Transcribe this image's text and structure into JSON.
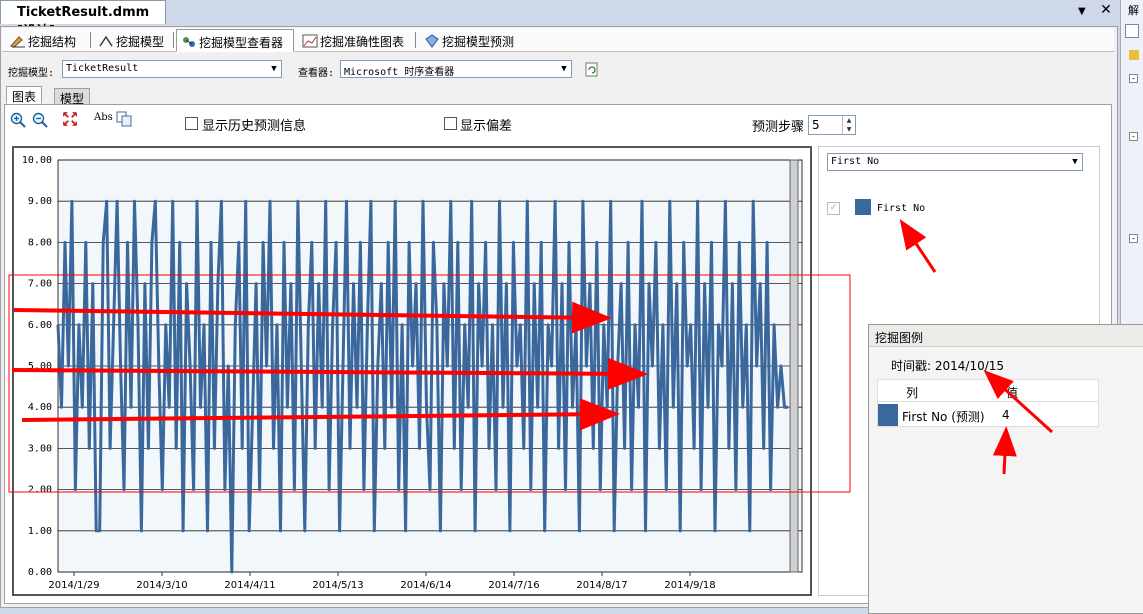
{
  "document": {
    "tab_title": "TicketResult.dmm [设计]",
    "pin_icon": "▼",
    "close_icon": "✕"
  },
  "right_strip": {
    "label": "解"
  },
  "designer_tabs": [
    {
      "label": "挖掘结构",
      "icon": "mining-structure-icon"
    },
    {
      "label": "挖掘模型",
      "icon": "mining-models-icon"
    },
    {
      "label": "挖掘模型查看器",
      "icon": "model-viewer-icon"
    },
    {
      "label": "挖掘准确性图表",
      "icon": "accuracy-chart-icon"
    },
    {
      "label": "挖掘模型预测",
      "icon": "prediction-icon"
    }
  ],
  "model_bar": {
    "model_label": "挖掘模型:",
    "model_value": "TicketResult",
    "viewer_label": "查看器:",
    "viewer_value": "Microsoft 时序查看器"
  },
  "sub_tabs": {
    "chart": "图表",
    "model": "模型"
  },
  "toolbar": {
    "abs_label": "Abs",
    "show_history": "显示历史预测信息",
    "show_deviation": "显示偏差",
    "prediction_steps_label": "预测步骤",
    "prediction_steps_value": "5"
  },
  "legend_panel": {
    "series_select": "First No",
    "item_label": "First No",
    "series_color": "#3a679c"
  },
  "popup": {
    "title": "挖掘图例",
    "timestamp": "时间戳: 2014/10/15",
    "col_header": "列",
    "val_header": "值",
    "row_label": "First No (预测)",
    "row_value": "4"
  },
  "colors": {
    "annotation": "#ff0000",
    "series": "#3a679c",
    "plot_bg": "#f2f7fc"
  },
  "chart_data": {
    "type": "line",
    "y_ticks": [
      "0.00",
      "1.00",
      "2.00",
      "3.00",
      "4.00",
      "5.00",
      "6.00",
      "7.00",
      "8.00",
      "9.00",
      "10.00"
    ],
    "x_ticks": [
      "2014/1/29",
      "2014/3/10",
      "2014/4/11",
      "2014/5/13",
      "2014/6/14",
      "2014/7/16",
      "2014/8/17",
      "2014/9/18"
    ],
    "ylim": [
      0,
      10
    ],
    "grid": true,
    "series": [
      {
        "name": "First No",
        "values": [
          6,
          4,
          8,
          5,
          9,
          2,
          6,
          4,
          8,
          3,
          7,
          1,
          1,
          8,
          9,
          3,
          6,
          9,
          5,
          2,
          8,
          4,
          9,
          6,
          1,
          7,
          3,
          8,
          9,
          5,
          2,
          6,
          4,
          9,
          3,
          8,
          1,
          7,
          5,
          2,
          9,
          4,
          6,
          1,
          8,
          3,
          7,
          9,
          2,
          5,
          0,
          6,
          8,
          3,
          9,
          1,
          4,
          7,
          2,
          8,
          5,
          9,
          3,
          6,
          1,
          8,
          4,
          7,
          2,
          9,
          5,
          1,
          6,
          8,
          3,
          7,
          4,
          9,
          2,
          6,
          8,
          1,
          5,
          9,
          3,
          7,
          4,
          8,
          2,
          6,
          9,
          1,
          5,
          7,
          3,
          8,
          4,
          9,
          2,
          6,
          1,
          8,
          5,
          7,
          3,
          9,
          4,
          2,
          8,
          6,
          1,
          7,
          5,
          9,
          3,
          8,
          2,
          6,
          4,
          9,
          1,
          7,
          5,
          8,
          3,
          6,
          2,
          9,
          4,
          7,
          1,
          8,
          5,
          6,
          3,
          9,
          2,
          7,
          4,
          8,
          1,
          6,
          5,
          9,
          3,
          7,
          2,
          8,
          4,
          6,
          1,
          9,
          5,
          7,
          3,
          8,
          2,
          6,
          4,
          9,
          1,
          5,
          7,
          3,
          8,
          2,
          6,
          4,
          9,
          1,
          7,
          5,
          8,
          3,
          6,
          2,
          9,
          4,
          7,
          1,
          8,
          5,
          6,
          3,
          9,
          2,
          7,
          4,
          8,
          1,
          6,
          5,
          9,
          3,
          7,
          2,
          8,
          4,
          6,
          1,
          9,
          5,
          7,
          3,
          8,
          2,
          6,
          4,
          5,
          4,
          4
        ]
      }
    ]
  }
}
